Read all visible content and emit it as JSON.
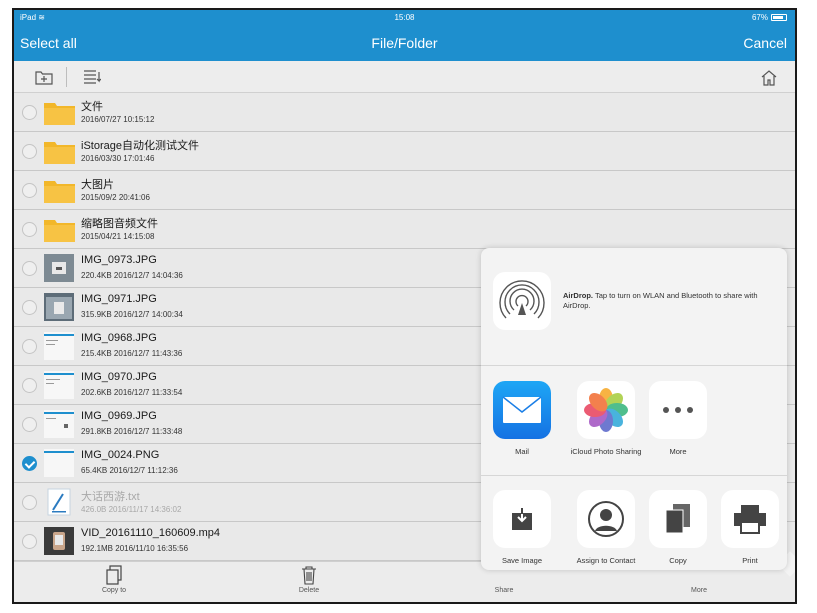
{
  "status_bar": {
    "device": "iPad",
    "time": "15:08",
    "battery": "67%"
  },
  "nav": {
    "left_label": "Select all",
    "title": "File/Folder",
    "right_label": "Cancel"
  },
  "toolbar": {
    "icons": [
      "new-folder-icon",
      "sort-list-icon",
      "home-icon"
    ]
  },
  "files": [
    {
      "name": "文件",
      "meta": "2016/07/27 10:15:12",
      "type": "folder",
      "selected": false
    },
    {
      "name": "iStorage自动化测试文件",
      "meta": "2016/03/30 17:01:46",
      "type": "folder",
      "selected": false
    },
    {
      "name": "大图片",
      "meta": "2015/09/2 20:41:06",
      "type": "folder",
      "selected": false
    },
    {
      "name": "缩略图音频文件",
      "meta": "2015/04/21 14:15:08",
      "type": "folder",
      "selected": false
    },
    {
      "name": "IMG_0973.JPG",
      "meta": "220.4KB 2016/12/7 14:04:36",
      "type": "photo",
      "selected": false
    },
    {
      "name": "IMG_0971.JPG",
      "meta": "315.9KB 2016/12/7 14:00:34",
      "type": "photo",
      "selected": false
    },
    {
      "name": "IMG_0968.JPG",
      "meta": "215.4KB 2016/12/7 11:43:36",
      "type": "screenshot",
      "selected": false
    },
    {
      "name": "IMG_0970.JPG",
      "meta": "202.6KB 2016/12/7 11:33:54",
      "type": "screenshot",
      "selected": false
    },
    {
      "name": "IMG_0969.JPG",
      "meta": "291.8KB 2016/12/7 11:33:48",
      "type": "screenshot",
      "selected": false
    },
    {
      "name": "IMG_0024.PNG",
      "meta": "65.4KB 2016/12/7 11:12:36",
      "type": "screenshot",
      "selected": true
    },
    {
      "name": "大话西游.txt",
      "meta": "426.0B 2016/11/17 14:36:02",
      "type": "text",
      "selected": false,
      "dimmed": true
    },
    {
      "name": "VID_20161110_160609.mp4",
      "meta": "192.1MB 2016/11/10 16:35:56",
      "type": "video",
      "selected": false
    }
  ],
  "bottom_bar": {
    "copy_to": "Copy to",
    "delete": "Delete",
    "share": "Share",
    "more": "More"
  },
  "share_sheet": {
    "airdrop_title": "AirDrop.",
    "airdrop_desc": " Tap to turn on WLAN and Bluetooth to share with AirDrop.",
    "apps": [
      {
        "label": "Mail",
        "icon": "mail-icon"
      },
      {
        "label": "iCloud Photo Sharing",
        "icon": "photos-icon"
      },
      {
        "label": "More",
        "icon": "more-icon"
      }
    ],
    "actions": [
      {
        "label": "Save Image",
        "icon": "save-image-icon"
      },
      {
        "label": "Assign to Contact",
        "icon": "contact-icon"
      },
      {
        "label": "Copy",
        "icon": "copy-icon"
      },
      {
        "label": "Print",
        "icon": "print-icon"
      }
    ]
  },
  "colors": {
    "accent": "#1e8fce",
    "folder": "#f2b72a"
  }
}
